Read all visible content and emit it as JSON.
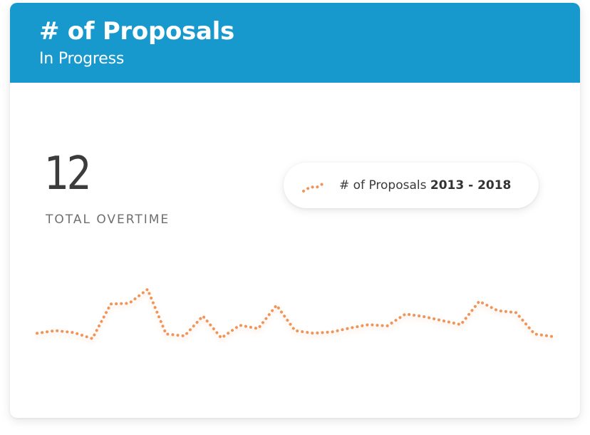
{
  "header": {
    "title": "# of Proposals",
    "subtitle": "In Progress"
  },
  "summary": {
    "value": "12",
    "label": "TOTAL OVERTIME"
  },
  "legend": {
    "label": "# of Proposals",
    "range": "2013 - 2018"
  },
  "colors": {
    "header_bg": "#1899cd",
    "series": "#f0955a"
  },
  "chart_data": {
    "type": "line",
    "title": "",
    "xlabel": "",
    "ylabel": "",
    "grid": false,
    "legend_position": "top-right",
    "line_style": "dotted",
    "series": [
      {
        "name": "# of Proposals 2013 - 2018",
        "values": [
          5.0,
          5.4,
          5.1,
          4.2,
          9.4,
          9.5,
          11.6,
          4.9,
          4.6,
          7.6,
          4.3,
          6.2,
          5.7,
          9.2,
          5.4,
          5.0,
          5.2,
          5.8,
          6.3,
          6.1,
          7.9,
          7.5,
          6.9,
          6.3,
          9.8,
          8.4,
          8.1,
          4.9,
          4.5
        ]
      }
    ],
    "ylim": [
      0,
      15
    ]
  }
}
